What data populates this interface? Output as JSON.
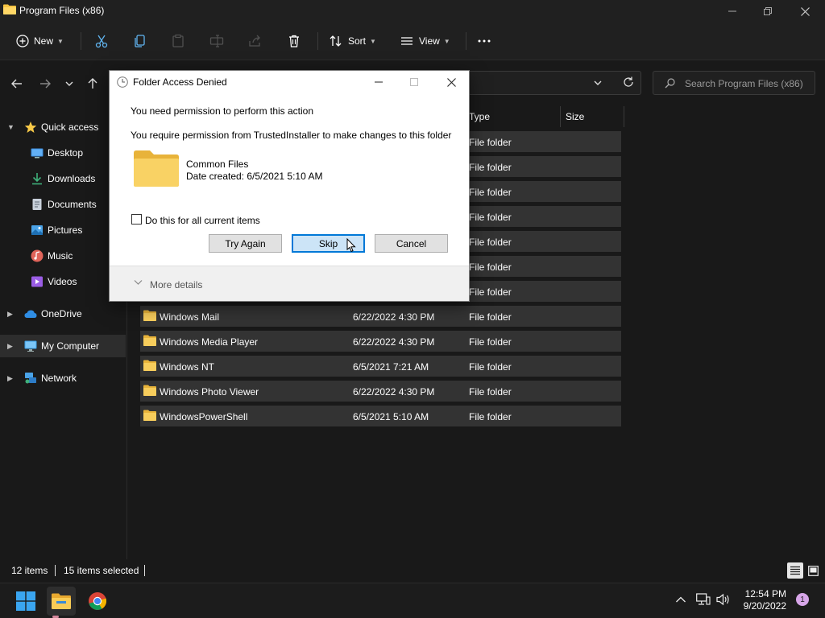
{
  "window": {
    "title": "Program Files (x86)"
  },
  "commandbar": {
    "new_label": "New",
    "sort_label": "Sort",
    "view_label": "View"
  },
  "search": {
    "placeholder": "Search Program Files (x86)"
  },
  "sidebar": {
    "items": [
      {
        "label": "Quick access",
        "icon": "star-icon"
      },
      {
        "label": "Desktop",
        "icon": "desktop-icon"
      },
      {
        "label": "Downloads",
        "icon": "download-icon"
      },
      {
        "label": "Documents",
        "icon": "documents-icon"
      },
      {
        "label": "Pictures",
        "icon": "pictures-icon"
      },
      {
        "label": "Music",
        "icon": "music-icon"
      },
      {
        "label": "Videos",
        "icon": "videos-icon"
      },
      {
        "label": "OneDrive",
        "icon": "cloud-icon"
      },
      {
        "label": "My Computer",
        "icon": "computer-icon"
      },
      {
        "label": "Network",
        "icon": "network-icon"
      }
    ]
  },
  "filelist": {
    "columns": {
      "type": "Type",
      "size": "Size"
    },
    "hidden_rows_type": "File folder",
    "rows": [
      {
        "name": "Windows Mail",
        "date": "6/22/2022 4:30 PM",
        "type": "File folder"
      },
      {
        "name": "Windows Media Player",
        "date": "6/22/2022 4:30 PM",
        "type": "File folder"
      },
      {
        "name": "Windows NT",
        "date": "6/5/2021 7:21 AM",
        "type": "File folder"
      },
      {
        "name": "Windows Photo Viewer",
        "date": "6/22/2022 4:30 PM",
        "type": "File folder"
      },
      {
        "name": "WindowsPowerShell",
        "date": "6/5/2021 5:10 AM",
        "type": "File folder"
      }
    ]
  },
  "statusbar": {
    "items_count": "12 items",
    "selected_count": "15 items selected"
  },
  "taskbar": {
    "time": "12:54 PM",
    "date": "9/20/2022",
    "notification_count": "1"
  },
  "dialog": {
    "title": "Folder Access Denied",
    "message1": "You need permission to perform this action",
    "message2": "You require permission from TrustedInstaller to make changes to this folder",
    "item_name": "Common Files",
    "item_date": "Date created: 6/5/2021 5:10 AM",
    "checkbox_label": "Do this for all current items",
    "try_again_label": "Try Again",
    "skip_label": "Skip",
    "cancel_label": "Cancel",
    "more_details_label": "More details"
  },
  "colors": {
    "accent": "#0078d7",
    "folder": "#f5c342",
    "row_selected": "#333333"
  }
}
